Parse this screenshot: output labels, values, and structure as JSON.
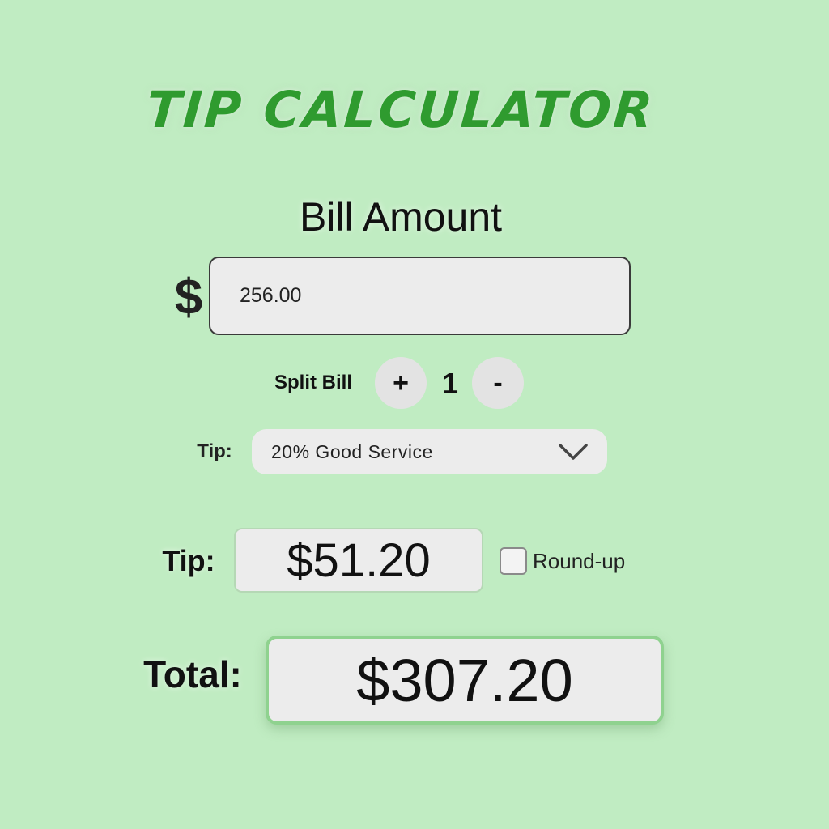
{
  "app": {
    "title": "TIP CALCULATOR"
  },
  "bill": {
    "heading": "Bill Amount",
    "currency_symbol": "$",
    "value": "256.00"
  },
  "split": {
    "label": "Split Bill",
    "plus_label": "+",
    "count": "1",
    "minus_label": "-"
  },
  "tip_select": {
    "label": "Tip:",
    "selected": "20% Good Service",
    "chevron_icon": "chevron-down-icon"
  },
  "tip_result": {
    "label": "Tip:",
    "value": "$51.20",
    "roundup_label": "Round-up",
    "roundup_checked": false
  },
  "total": {
    "label": "Total:",
    "value": "$307.20"
  },
  "colors": {
    "background": "#c0ecc2",
    "title": "#2f9b2f",
    "field": "#ececec",
    "total_border": "#8fd28f"
  }
}
